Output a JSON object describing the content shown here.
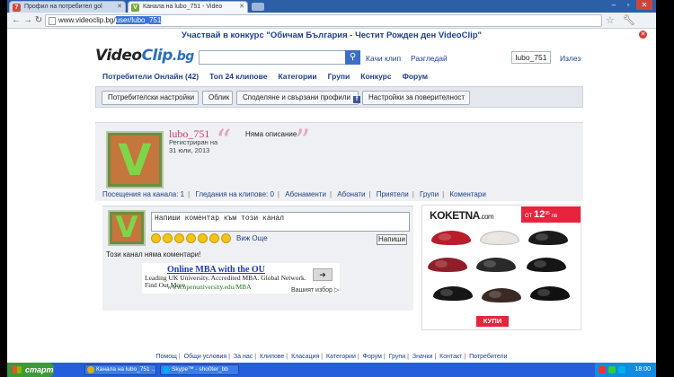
{
  "browser": {
    "tabs": [
      {
        "title": "Профил на потребител gol",
        "favicon": "7"
      },
      {
        "title": "Канала на lubo_751 - Video",
        "favicon": "V"
      }
    ],
    "url_host": "www.videoclip.bg/",
    "url_selected_a": "user",
    "url_selected_b": "/lubo_751"
  },
  "promo": {
    "text": "Участвай в конкурс \"Обичам България - Честит Рожден ден VideoClip\""
  },
  "logo": {
    "part1": "Video",
    "part2": "Clip",
    "part3": ".bg"
  },
  "top_links": {
    "upload": "Качи клип",
    "browse": "Разгледай",
    "username": "lubo_751",
    "logout": "Излез"
  },
  "main_nav": [
    "Потребители Онлайн (42)",
    "Топ 24 клипове",
    "Категории",
    "Групи",
    "Конкурс",
    "Форум"
  ],
  "sub_tabs": [
    "Потребителски настройки",
    "Облик",
    "Споделяне и свързани профили",
    "Настройки за поверителност"
  ],
  "profile": {
    "username": "lubo_751",
    "reg_label": "Регистриран на",
    "reg_date": "31 юли, 2013",
    "description": "Няма описание",
    "avatar_letter": "V",
    "links": [
      "Посещения на канала: 1",
      "Гледания на клипове: 0",
      "Абонаменти",
      "Абонати",
      "Приятели",
      "Групи",
      "Коментари"
    ]
  },
  "comments": {
    "input_value": "Напиши коментар към този канал",
    "see_more": "Виж Още",
    "submit": "Напиши",
    "empty": "Този канал няма коментари!"
  },
  "ad": {
    "title": "Online MBA with the OU",
    "text": "Leading UK University. Accredited MBA. Global Network. Find Out More",
    "url": "www.openuniversity.edu/MBA",
    "choice": "Вашият избор"
  },
  "shoe_ad": {
    "brand": "KOKETNA",
    "brand_suffix": ".com",
    "price_prefix": "ОТ",
    "price_main": "12",
    "price_cents": "95",
    "currency": "лв",
    "buy": "КУПИ"
  },
  "footer": [
    "Помощ",
    "Общи условия",
    "За нас",
    "Клипове",
    "Класация",
    "Категории",
    "Форум",
    "Групи",
    "Значки",
    "Контакт",
    "Потребители"
  ],
  "taskbar": {
    "start": "старт",
    "items": [
      "Канала на lubo_751 ...",
      "Skype™ - sho0ter_bb"
    ],
    "clock": "18:00"
  },
  "colors": {
    "accent": "#1c3f8a",
    "brand_blue": "#2c6fb7",
    "username_pink": "#c13a6a",
    "ad_red": "#e7243d"
  }
}
